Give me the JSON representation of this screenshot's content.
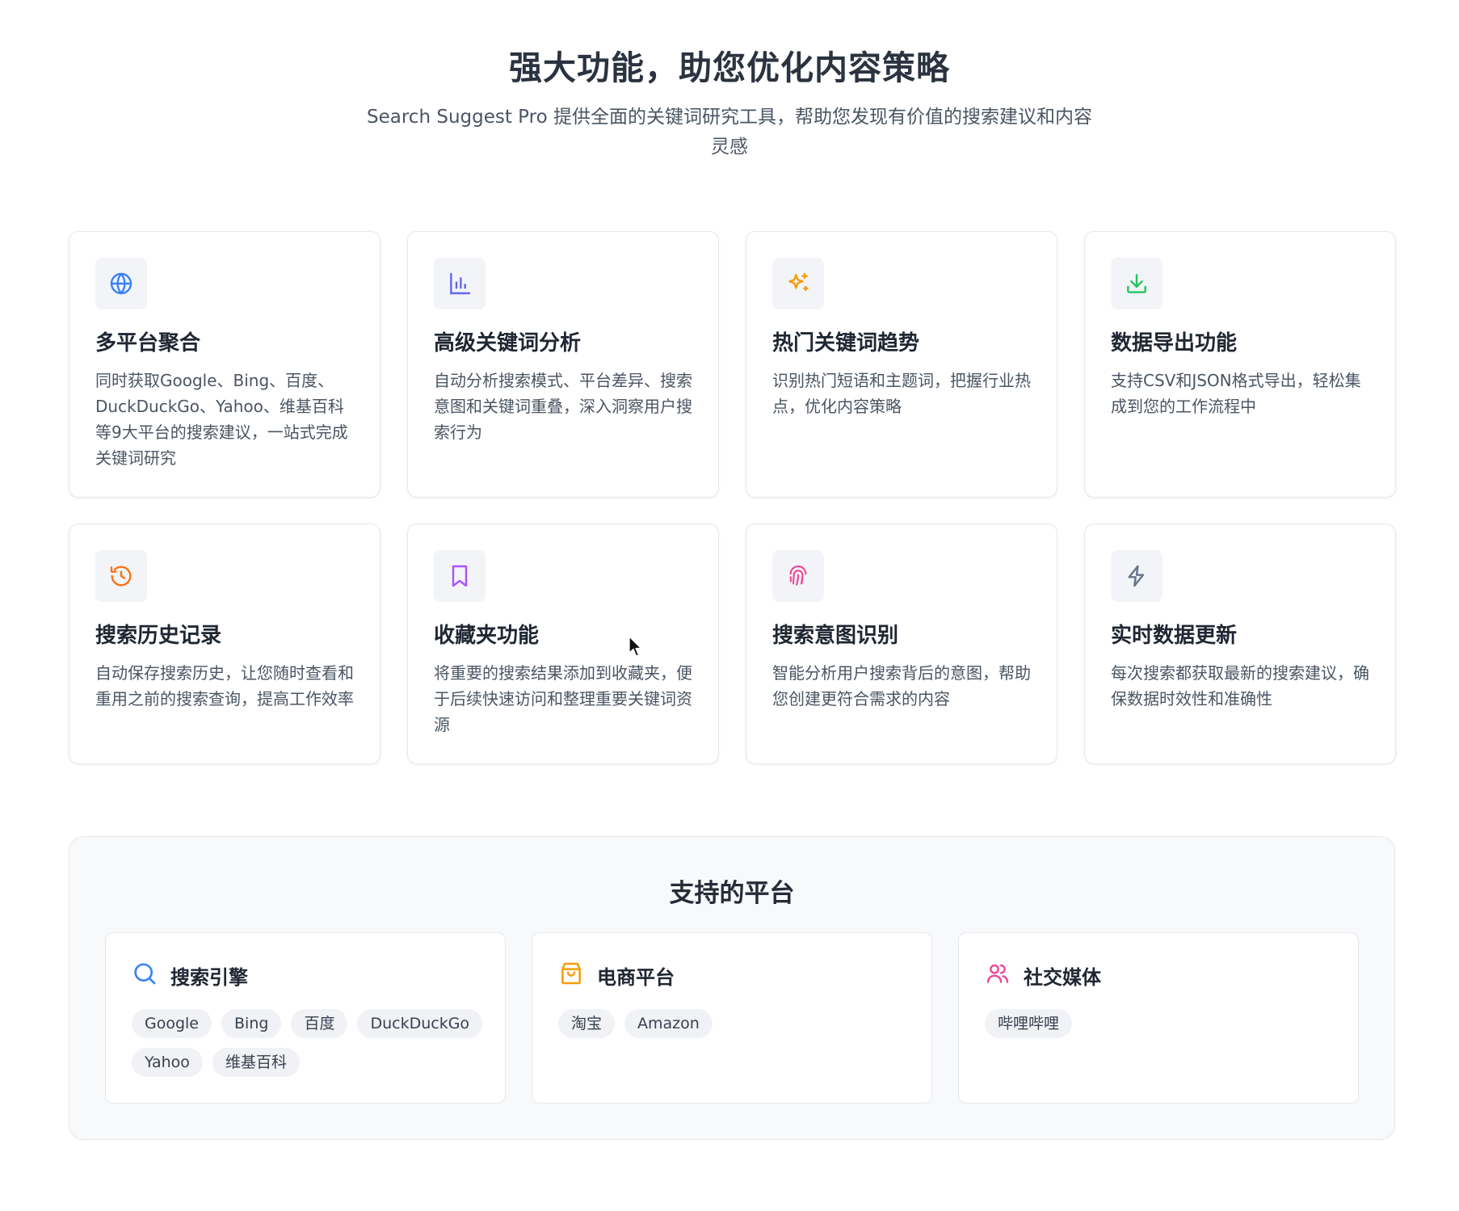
{
  "header": {
    "title": "强大功能，助您优化内容策略",
    "subtitle": "Search Suggest Pro 提供全面的关键词研究工具，帮助您发现有价值的搜索建议和内容灵感"
  },
  "features": [
    {
      "icon": "globe-icon",
      "color": "#3b82f6",
      "title": "多平台聚合",
      "desc": "同时获取Google、Bing、百度、DuckDuckGo、Yahoo、维基百科等9大平台的搜索建议，一站式完成关键词研究"
    },
    {
      "icon": "bar-chart-icon",
      "color": "#6366f1",
      "title": "高级关键词分析",
      "desc": "自动分析搜索模式、平台差异、搜索意图和关键词重叠，深入洞察用户搜索行为"
    },
    {
      "icon": "sparkles-icon",
      "color": "#f59e0b",
      "title": "热门关键词趋势",
      "desc": "识别热门短语和主题词，把握行业热点，优化内容策略"
    },
    {
      "icon": "download-icon",
      "color": "#22c55e",
      "title": "数据导出功能",
      "desc": "支持CSV和JSON格式导出，轻松集成到您的工作流程中"
    },
    {
      "icon": "history-icon",
      "color": "#f97316",
      "title": "搜索历史记录",
      "desc": "自动保存搜索历史，让您随时查看和重用之前的搜索查询，提高工作效率"
    },
    {
      "icon": "bookmark-icon",
      "color": "#a855f7",
      "title": "收藏夹功能",
      "desc": "将重要的搜索结果添加到收藏夹，便于后续快速访问和整理重要关键词资源"
    },
    {
      "icon": "fingerprint-icon",
      "color": "#ec4899",
      "title": "搜索意图识别",
      "desc": "智能分析用户搜索背后的意图，帮助您创建更符合需求的内容"
    },
    {
      "icon": "lightning-icon",
      "color": "#64748b",
      "title": "实时数据更新",
      "desc": "每次搜索都获取最新的搜索建议，确保数据时效性和准确性"
    }
  ],
  "platforms": {
    "title": "支持的平台",
    "groups": [
      {
        "icon": "search-icon",
        "color": "#3b82f6",
        "title": "搜索引擎",
        "tags": [
          "Google",
          "Bing",
          "百度",
          "DuckDuckGo",
          "Yahoo",
          "维基百科"
        ]
      },
      {
        "icon": "shopping-bag-icon",
        "color": "#f59e0b",
        "title": "电商平台",
        "tags": [
          "淘宝",
          "Amazon"
        ]
      },
      {
        "icon": "users-icon",
        "color": "#ec4899",
        "title": "社交媒体",
        "tags": [
          "哔哩哔哩"
        ]
      }
    ]
  }
}
